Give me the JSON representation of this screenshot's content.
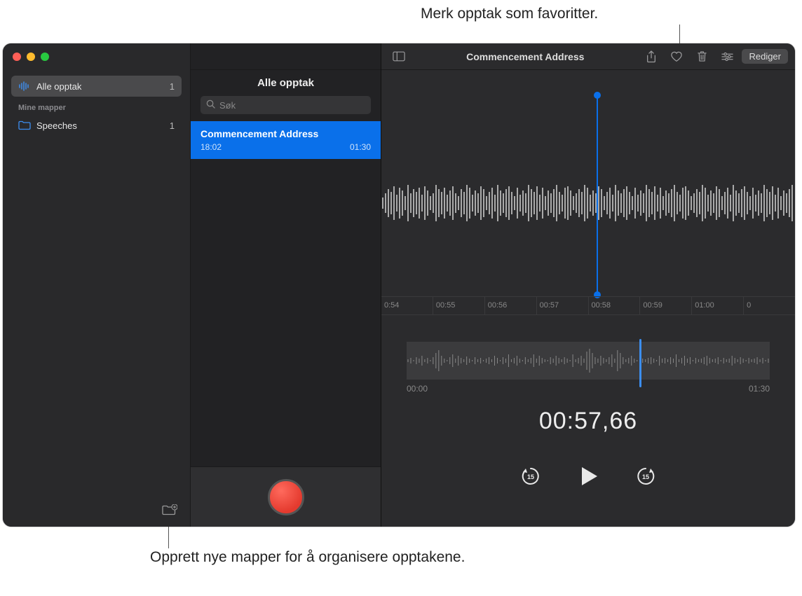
{
  "annotations": {
    "top": "Merk opptak som favoritter.",
    "bottom": "Opprett nye mapper for å organisere opptakene."
  },
  "sidebar": {
    "items": [
      {
        "label": "Alle opptak",
        "count": "1",
        "icon": "waveform-icon",
        "selected": true
      }
    ],
    "section_header": "Mine mapper",
    "folders": [
      {
        "label": "Speeches",
        "count": "1",
        "icon": "folder-icon"
      }
    ]
  },
  "list": {
    "header": "Alle opptak",
    "search_placeholder": "Søk",
    "recordings": [
      {
        "title": "Commencement Address",
        "time": "18:02",
        "duration": "01:30",
        "selected": true
      }
    ]
  },
  "toolbar": {
    "title": "Commencement Address",
    "edit_label": "Rediger"
  },
  "timeline": {
    "ticks": [
      "0:54",
      "00:55",
      "00:56",
      "00:57",
      "00:58",
      "00:59",
      "01:00",
      "0"
    ]
  },
  "overview": {
    "start": "00:00",
    "end": "01:30"
  },
  "current_time": "00:57,66",
  "skip_seconds": "15",
  "colors": {
    "accent": "#0a70ea",
    "record": "#e43a2e"
  }
}
